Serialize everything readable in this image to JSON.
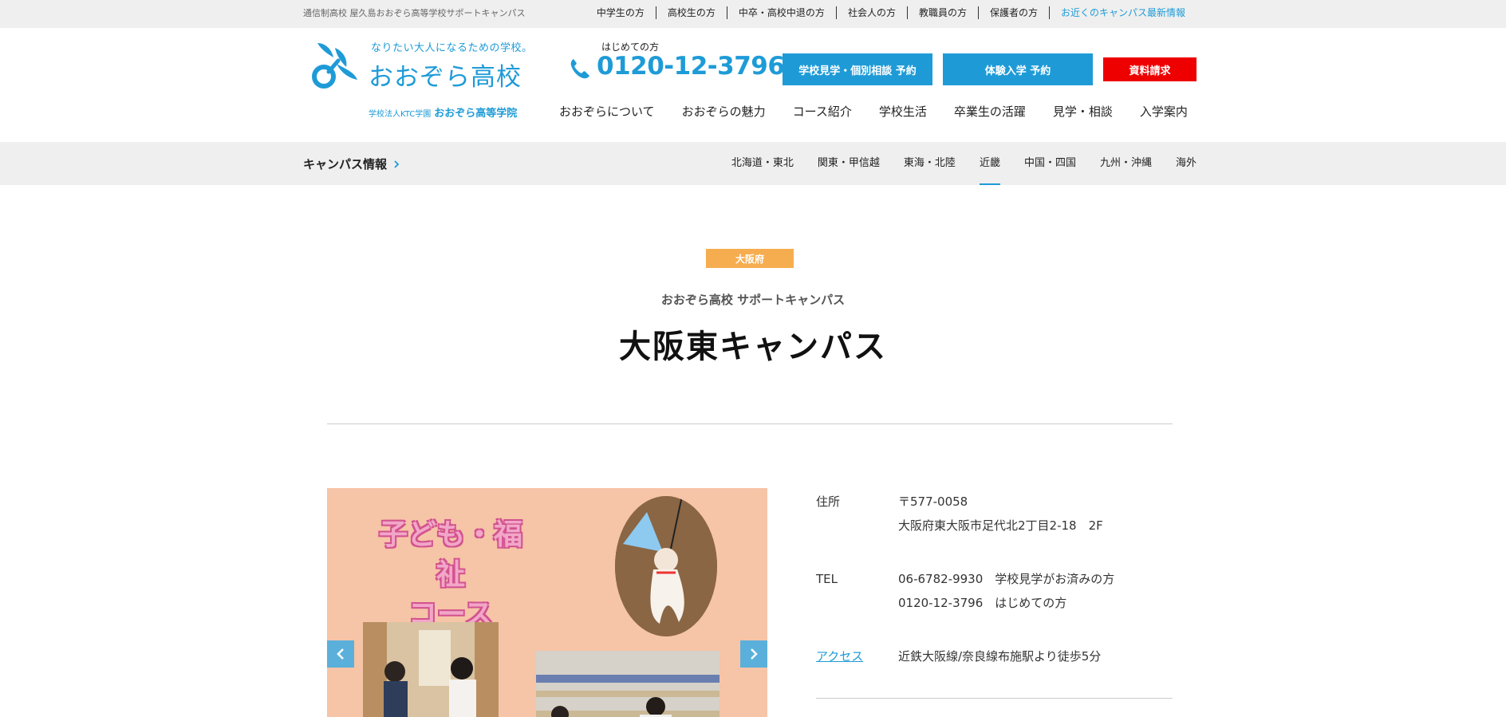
{
  "topbar": {
    "tagline": "通信制高校 屋久島おおぞら高等学校サポートキャンパス",
    "links": [
      "中学生の方",
      "高校生の方",
      "中卒・高校中退の方",
      "社会人の方",
      "教職員の方",
      "保護者の方",
      "お近くのキャンパス最新情報"
    ]
  },
  "logo": {
    "slogan": "なりたい大人になるための学校。",
    "name": "おおぞら高校",
    "corp_small": "学校法人KTC学園",
    "corp_big": "おおぞら高等学院"
  },
  "phone": {
    "label": "はじめての方",
    "number": "0120-12-3796"
  },
  "cta": {
    "visit": "学校見学・個別相談 予約",
    "trial": "体験入学 予約",
    "docs": "資料請求"
  },
  "mainnav": [
    "おおぞらについて",
    "おおぞらの魅力",
    "コース紹介",
    "学校生活",
    "卒業生の活躍",
    "見学・相談",
    "入学案内"
  ],
  "campusbar": {
    "title": "キャンパス情報",
    "regions": [
      "北海道・東北",
      "関東・甲信越",
      "東海・北陸",
      "近畿",
      "中国・四国",
      "九州・沖縄",
      "海外"
    ],
    "active_region": "近畿"
  },
  "page": {
    "prefecture": "大阪府",
    "subtitle": "おおぞら高校 サポートキャンパス",
    "title": "大阪東キャンパス"
  },
  "slider": {
    "slide_text_line1": "子ども・福祉",
    "slide_text_line2": "コース"
  },
  "info": {
    "address_label": "住所",
    "postal": "〒577-0058",
    "address": "大阪府東大阪市足代北2丁目2-18　2F",
    "tel_label": "TEL",
    "tel1": "06-6782-9930　学校見学がお済みの方",
    "tel2": "0120-12-3796　はじめての方",
    "access_label": "アクセス",
    "access": "近鉄大阪線/奈良線布施駅より徒歩5分"
  },
  "colors": {
    "brand_blue": "#1e9bd7",
    "cta_red": "#ee0000",
    "badge_orange": "#f6ad4f",
    "slide_bg": "#f6c4a7"
  }
}
